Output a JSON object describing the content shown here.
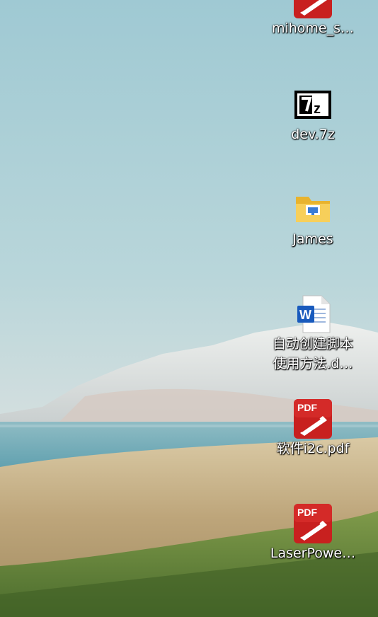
{
  "desktop": {
    "icons": [
      {
        "label": "mihome_s…",
        "icon": "pdf-icon"
      },
      {
        "label": "dev.7z",
        "icon": "7z-archive-icon"
      },
      {
        "label": "James",
        "icon": "folder-icon"
      },
      {
        "label_line1": "自动创建脚本",
        "label_line2": "使用方法.d…",
        "icon": "word-document-icon"
      },
      {
        "label": "软件i2c.pdf",
        "icon": "pdf-icon"
      },
      {
        "label": "LaserPowe…",
        "icon": "pdf-icon"
      }
    ],
    "pdf_badge": "PDF",
    "word_badge": "W",
    "sevenzip_badge": "7z"
  },
  "colors": {
    "sky_top": "#a8cfd6",
    "sky_bottom": "#d8e2e2",
    "water": "#6fa9b6",
    "grass_dry": "#c9b48a",
    "grass_green": "#5f7d3a",
    "pdf_red": "#c8201f",
    "word_blue": "#185abd",
    "folder_yellow": "#f4c74a"
  }
}
